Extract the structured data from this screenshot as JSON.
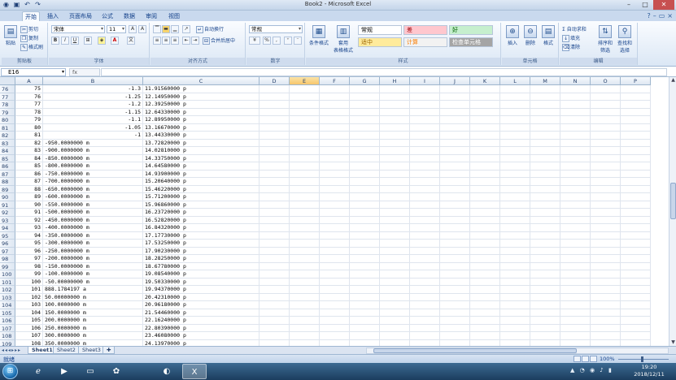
{
  "window": {
    "title": "Book2 - Microsoft Excel"
  },
  "ribbon_tabs": [
    "开始",
    "插入",
    "页面布局",
    "公式",
    "数据",
    "审阅",
    "视图"
  ],
  "ribbon": {
    "clipboard": {
      "paste": "粘贴",
      "cut": "剪切",
      "copy": "复制",
      "format_painter": "格式刷",
      "group": "剪贴板"
    },
    "font": {
      "family": "宋体",
      "size": "11",
      "bold": "B",
      "italic": "I",
      "underline": "U",
      "font_color_glyph": "A",
      "grow": "A",
      "shrink": "A",
      "group": "字体"
    },
    "alignment": {
      "wrap": "自动换行",
      "merge": "合并后居中",
      "group": "对齐方式"
    },
    "number": {
      "format": "常规",
      "percent": "%",
      "comma": ",",
      "group": "数字"
    },
    "styles": {
      "conditional": "条件格式",
      "table": "套用",
      "table2": "表格格式",
      "cells": [
        {
          "label": "常规",
          "bg": "#ffffff",
          "fg": "#000000"
        },
        {
          "label": "差",
          "bg": "#ffc7ce",
          "fg": "#9c0006"
        },
        {
          "label": "好",
          "bg": "#c6efce",
          "fg": "#006100"
        },
        {
          "label": "适中",
          "bg": "#ffeb9c",
          "fg": "#9c6500"
        },
        {
          "label": "计算",
          "bg": "#f2f2f2",
          "fg": "#fa7d00"
        },
        {
          "label": "检查单元格",
          "bg": "#a5a5a5",
          "fg": "#ffffff"
        }
      ],
      "group": "样式"
    },
    "cells_group": {
      "insert": "插入",
      "delete": "删除",
      "format": "格式",
      "group": "单元格"
    },
    "editing": {
      "autosum": "自动求和",
      "fill": "填充",
      "clear": "清除",
      "sort": "排序和",
      "sort2": "筛选",
      "find": "查找和",
      "find2": "选择",
      "group": "编辑"
    }
  },
  "formula_bar": {
    "name_box": "E16",
    "fx": "fx",
    "formula": ""
  },
  "columns": [
    "A",
    "B",
    "C",
    "D",
    "E",
    "F",
    "G",
    "H",
    "I",
    "J",
    "K",
    "L",
    "M",
    "N",
    "O",
    "P"
  ],
  "selected_column": "E",
  "rows": [
    {
      "r": "76",
      "a": "75",
      "b": "-1.3",
      "b_num": true,
      "c": "11.91560000 p"
    },
    {
      "r": "77",
      "a": "76",
      "b": "-1.25",
      "b_num": true,
      "c": "12.14950000 p"
    },
    {
      "r": "78",
      "a": "77",
      "b": "-1.2",
      "b_num": true,
      "c": "12.39250000 p"
    },
    {
      "r": "79",
      "a": "78",
      "b": "-1.15",
      "b_num": true,
      "c": "12.64330000 p"
    },
    {
      "r": "80",
      "a": "79",
      "b": "-1.1",
      "b_num": true,
      "c": "12.89950000 p"
    },
    {
      "r": "81",
      "a": "80",
      "b": "-1.05",
      "b_num": true,
      "c": "13.16670000 p"
    },
    {
      "r": "82",
      "a": "81",
      "b": "-1",
      "b_num": true,
      "c": "13.44330000 p"
    },
    {
      "r": "83",
      "a": "82",
      "b": "-950.0000000 m",
      "b_num": false,
      "c": "13.72820000 p"
    },
    {
      "r": "84",
      "a": "83",
      "b": "-900.0000000 m",
      "b_num": false,
      "c": "14.02810000 p"
    },
    {
      "r": "85",
      "a": "84",
      "b": "-850.0000000 m",
      "b_num": false,
      "c": "14.33750000 p"
    },
    {
      "r": "86",
      "a": "85",
      "b": "-800.0000000 m",
      "b_num": false,
      "c": "14.64580000 p"
    },
    {
      "r": "87",
      "a": "86",
      "b": "-750.0000000 m",
      "b_num": false,
      "c": "14.93900000 p"
    },
    {
      "r": "88",
      "a": "87",
      "b": "-700.0000000 m",
      "b_num": false,
      "c": "15.20640000 p"
    },
    {
      "r": "89",
      "a": "88",
      "b": "-650.0000000 m",
      "b_num": false,
      "c": "15.46220000 p"
    },
    {
      "r": "90",
      "a": "89",
      "b": "-600.0000000 m",
      "b_num": false,
      "c": "15.71200000 p"
    },
    {
      "r": "91",
      "a": "90",
      "b": "-550.0000000 m",
      "b_num": false,
      "c": "15.96860000 p"
    },
    {
      "r": "92",
      "a": "91",
      "b": "-500.0000000 m",
      "b_num": false,
      "c": "16.23720000 p"
    },
    {
      "r": "93",
      "a": "92",
      "b": "-450.0000000 m",
      "b_num": false,
      "c": "16.52820000 p"
    },
    {
      "r": "94",
      "a": "93",
      "b": "-400.0000000 m",
      "b_num": false,
      "c": "16.84320000 p"
    },
    {
      "r": "95",
      "a": "94",
      "b": "-350.0000000 m",
      "b_num": false,
      "c": "17.17730000 p"
    },
    {
      "r": "96",
      "a": "95",
      "b": "-300.0000000 m",
      "b_num": false,
      "c": "17.53250000 p"
    },
    {
      "r": "97",
      "a": "96",
      "b": "-250.0000000 m",
      "b_num": false,
      "c": "17.90230000 p"
    },
    {
      "r": "98",
      "a": "97",
      "b": "-200.0000000 m",
      "b_num": false,
      "c": "18.28250000 p"
    },
    {
      "r": "99",
      "a": "98",
      "b": "-150.0000000 m",
      "b_num": false,
      "c": "18.67780000 p"
    },
    {
      "r": "100",
      "a": "99",
      "b": "-100.0000000 m",
      "b_num": false,
      "c": "19.08540000 p"
    },
    {
      "r": "101",
      "a": "100",
      "b": "-50.00000000 m",
      "b_num": false,
      "c": "19.50330000 p"
    },
    {
      "r": "102",
      "a": "101",
      "b": "888.1784197 a",
      "b_num": false,
      "c": "19.94370000 p"
    },
    {
      "r": "103",
      "a": "102",
      "b": "50.00000000 m",
      "b_num": false,
      "c": "20.42310000 p"
    },
    {
      "r": "104",
      "a": "103",
      "b": "100.0000000 m",
      "b_num": false,
      "c": "20.96180000 p"
    },
    {
      "r": "105",
      "a": "104",
      "b": "150.0000000 m",
      "b_num": false,
      "c": "21.54460000 p"
    },
    {
      "r": "106",
      "a": "105",
      "b": "200.0000000 m",
      "b_num": false,
      "c": "22.16240000 p"
    },
    {
      "r": "107",
      "a": "106",
      "b": "250.0000000 m",
      "b_num": false,
      "c": "22.80390000 p"
    },
    {
      "r": "108",
      "a": "107",
      "b": "300.0000000 m",
      "b_num": false,
      "c": "23.46080000 p"
    },
    {
      "r": "109",
      "a": "108",
      "b": "350.0000000 m",
      "b_num": false,
      "c": "24.13970000 p"
    }
  ],
  "sheets": [
    "Sheet1",
    "Sheet2",
    "Sheet3"
  ],
  "active_sheet": "Sheet1",
  "status": {
    "ready": "就绪",
    "zoom": "100%"
  },
  "taskbar": {
    "time": "19:20",
    "date": "2018/12/11"
  }
}
